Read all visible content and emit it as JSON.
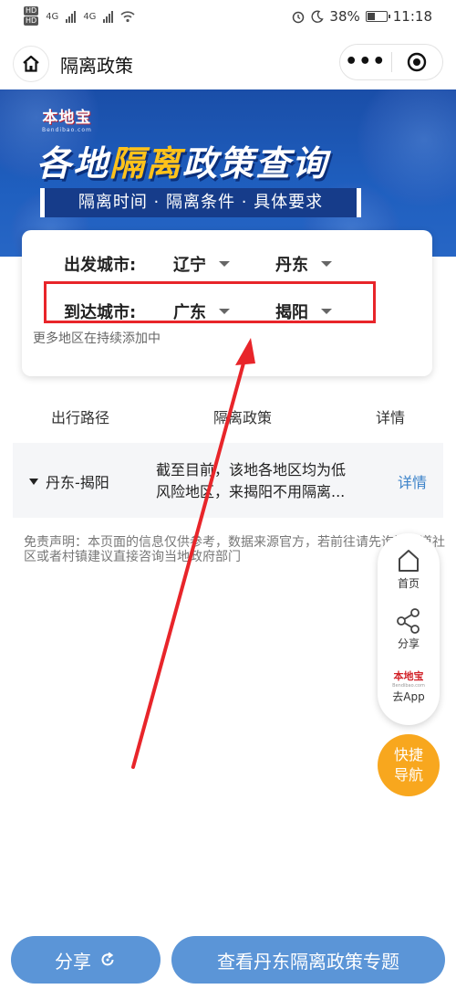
{
  "status_bar": {
    "network_badges": [
      "HD",
      "HD"
    ],
    "signal1_label": "4G",
    "signal2_label": "4G",
    "battery_percent": "38%",
    "time": "11:18"
  },
  "navbar": {
    "title": "隔离政策",
    "more_glyph": "•••"
  },
  "banner": {
    "brand_name": "本地宝",
    "brand_domain": "Bendibao.com",
    "title_part1": "各地",
    "title_highlight": "隔离",
    "title_part2": "政策查询",
    "subtitle": "隔离时间 · 隔离条件 · 具体要求"
  },
  "selector": {
    "departure_label": "出发城市:",
    "departure_province": "辽宁",
    "departure_city": "丹东",
    "arrival_label": "到达城市:",
    "arrival_province": "广东",
    "arrival_city": "揭阳",
    "note": "更多地区在持续添加中"
  },
  "table": {
    "headers": [
      "出行路径",
      "隔离政策",
      "详情"
    ],
    "rows": [
      {
        "route": "丹东-揭阳",
        "policy_line1": "截至目前，该地各地区均为低",
        "policy_line2": "风险地区，来揭阳不用隔离...",
        "detail": "详情"
      }
    ]
  },
  "disclaimer": "免责声明：本页面的信息仅供参考，数据来源官方，若前往请先询问街道社区或者村镇建议直接咨询当地政府部门",
  "side_menu": {
    "home": "首页",
    "share": "分享",
    "app_logo": "本地宝",
    "app_logo_sub": "Bendibao.com",
    "get_app": "去App",
    "quick_nav_line1": "快捷",
    "quick_nav_line2": "导航"
  },
  "bottom": {
    "share_label": "分享",
    "topic_label": "查看丹东隔离政策专题"
  },
  "colors": {
    "banner_blue": "#1f5fbf",
    "highlight_yellow": "#ffc21a",
    "annotation_red": "#e8252a",
    "button_blue": "#5b95d7",
    "quick_nav_orange": "#f8a71e",
    "link_blue": "#3b82c9"
  }
}
